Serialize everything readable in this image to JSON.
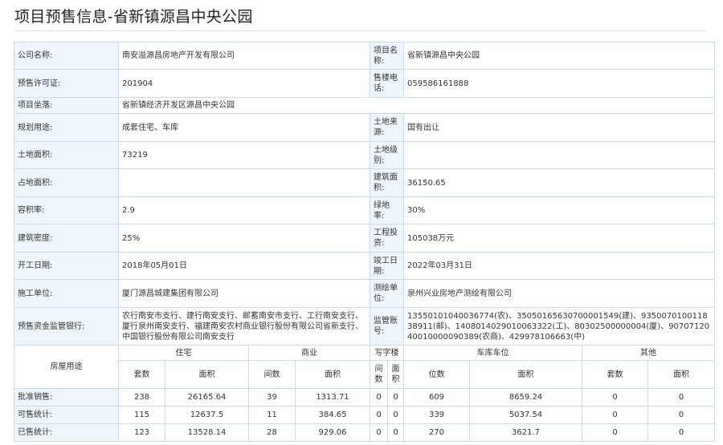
{
  "page_title": "项目预售信息-省新镇源昌中央公园",
  "info": {
    "company_label": "公司名称:",
    "company_value": "南安溢源昌房地产开发有限公司",
    "project_name_label": "项目名称:",
    "project_name_value": "省新镇源昌中央公园",
    "permit_label": "预售许可证:",
    "permit_value": "201904",
    "phone_label": "售楼电话:",
    "phone_value": "059586161888",
    "location_label": "项目坐落:",
    "location_value": "省新镇经济开发区源昌中央公园",
    "usage_label": "规划用途:",
    "usage_value": "成套住宅、车库",
    "land_source_label": "土地来源:",
    "land_source_value": "国有出让",
    "land_area_label": "土地面积:",
    "land_area_value": "73219",
    "land_grade_label": "土地级别:",
    "land_grade_value": "",
    "floor_area_label": "占地面积:",
    "floor_area_value": "",
    "building_area_label": "建筑面积:",
    "building_area_value": "36150.65",
    "plot_ratio_label": "容积率:",
    "plot_ratio_value": "2.9",
    "green_ratio_label": "绿地率:",
    "green_ratio_value": "30%",
    "density_label": "建筑密度:",
    "density_value": "25%",
    "investment_label": "工程投资:",
    "investment_value": "105038万元",
    "start_date_label": "开工日期:",
    "start_date_value": "2018年05月01日",
    "end_date_label": "竣工日期:",
    "end_date_value": "2022年03月31日",
    "builder_label": "施工单位:",
    "builder_value": "厦门源昌城建集团有限公司",
    "surveyor_label": "测绘单位:",
    "surveyor_value": "泉州兴业房地产测绘有限公司",
    "bank_label": "预售资金监管银行:",
    "bank_value": "农行南安市支行、建行南安支行、邮蓄南安市支行、工行南安支行、厦行泉州南安支行、福建南安农村商业银行股份有限公司省新支行、中国银行股份有限公司南安支行",
    "account_label": "监管账号:",
    "account_value": "13550101040036774(农)、35050165630700001549(建)、935007010011838911(邮)、1408014029010063322(工)、80302500000004(厦)、9070712040010000090389(农商)、429978106663(中)"
  },
  "stats": {
    "row_header": "房屋用途",
    "groups": [
      "住宅",
      "商业",
      "写字楼",
      "车库车位",
      "其他"
    ],
    "subheaders": [
      "套数",
      "面积",
      "间数",
      "面积",
      "间数",
      "面积",
      "位数",
      "面积",
      "套数",
      "面积"
    ],
    "rows": [
      {
        "label": "批准销售:",
        "values": [
          "238",
          "26165.64",
          "39",
          "1313.71",
          "0",
          "0",
          "609",
          "8659.24",
          "0",
          "0"
        ]
      },
      {
        "label": "可售统计:",
        "values": [
          "115",
          "12637.5",
          "11",
          "384.65",
          "0",
          "0",
          "339",
          "5037.54",
          "0",
          "0"
        ]
      },
      {
        "label": "已售统计:",
        "values": [
          "123",
          "13528.14",
          "28",
          "929.06",
          "0",
          "0",
          "270",
          "3621.7",
          "0",
          "0"
        ]
      }
    ]
  }
}
